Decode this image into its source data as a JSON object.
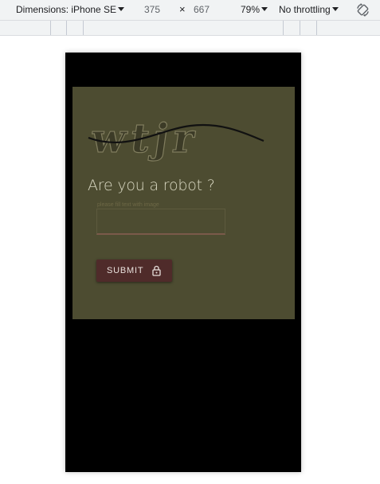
{
  "devtools": {
    "dimensions_label": "Dimensions: iPhone SE",
    "width": "375",
    "times": "×",
    "height": "667",
    "zoom": "79%",
    "throttling": "No throttling"
  },
  "form": {
    "captcha_text": "wtjr",
    "title": "Are you a robot ?",
    "field_label": "please fill text with image",
    "input_value": "",
    "submit_label": "SUBMIT"
  },
  "colors": {
    "card_bg": "#4d4c31",
    "device_bg": "#000000",
    "button_bg": "#4f2b2a",
    "title_text": "#d9d8c2"
  },
  "icons": [
    "caret-down-icon",
    "rotate-icon",
    "lock-icon"
  ]
}
